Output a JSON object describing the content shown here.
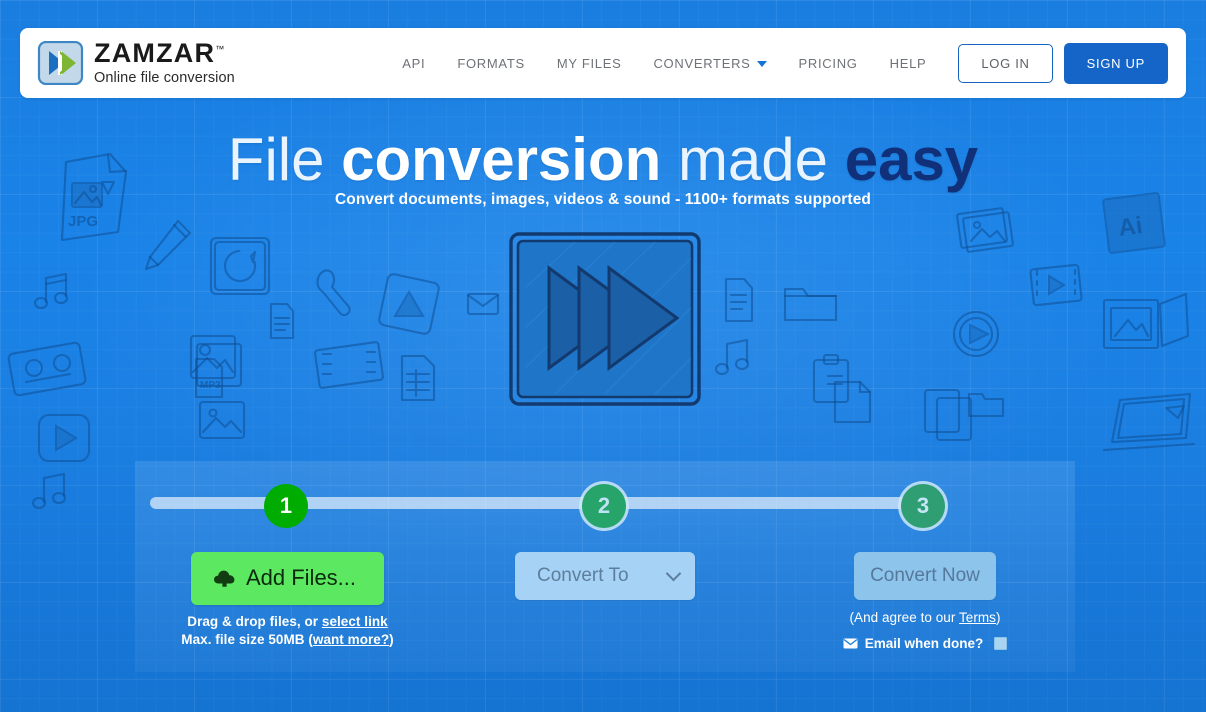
{
  "brand": {
    "logo_icon": "fast-forward-logo-icon",
    "name": "ZAMZAR",
    "tm": "™",
    "tagline": "Online file conversion"
  },
  "nav": {
    "items": [
      {
        "label": "API",
        "has_caret": false
      },
      {
        "label": "FORMATS",
        "has_caret": false
      },
      {
        "label": "MY FILES",
        "has_caret": false
      },
      {
        "label": "CONVERTERS",
        "has_caret": true
      },
      {
        "label": "PRICING",
        "has_caret": false
      },
      {
        "label": "HELP",
        "has_caret": false
      }
    ],
    "login_label": "LOG IN",
    "signup_label": "SIGN UP"
  },
  "hero": {
    "title_part1": "File ",
    "title_part2": "conversion ",
    "title_part3": "made ",
    "title_part4": "easy",
    "subtitle": "Convert documents, images, videos & sound - 1100+ formats supported",
    "graphic_icon": "fast-forward-sketch-icon"
  },
  "converter": {
    "steps": [
      {
        "number": "1",
        "state": "active"
      },
      {
        "number": "2",
        "state": "inactive"
      },
      {
        "number": "3",
        "state": "inactive"
      }
    ],
    "step1": {
      "button_label": "Add Files...",
      "button_icon": "upload-cloud-icon",
      "hint_prefix": "Drag & drop files, or ",
      "hint_link": "select link",
      "size_prefix": "Max. file size 50MB (",
      "size_link": "want more?",
      "size_suffix": ")"
    },
    "step2": {
      "select_value": "Convert To",
      "chevron_icon": "chevron-down-icon"
    },
    "step3": {
      "button_label": "Convert Now",
      "terms_prefix": "(And agree to our ",
      "terms_link": "Terms",
      "terms_suffix": ")",
      "email_icon": "envelope-icon",
      "email_label": "Email when done?",
      "email_checked": false
    }
  },
  "colors": {
    "background_blue": "#1a80e4",
    "header_white": "#ffffff",
    "signup_blue": "#1565c9",
    "add_files_green": "#5ce861",
    "step_active_green": "#00ac00",
    "step_inactive_green": "#27a46a",
    "disabled_blue": "#a6d2f5",
    "headline_dark": "#10307a",
    "doodle_stroke": "#0f4f94"
  }
}
